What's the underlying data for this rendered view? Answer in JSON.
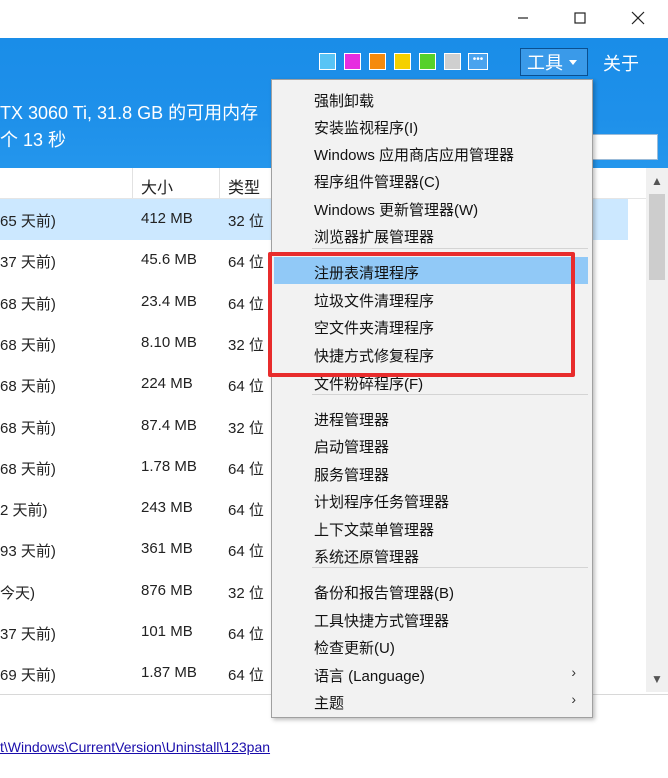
{
  "header": {
    "system_info": "TX 3060 Ti, 31.8 GB 的可用内存",
    "time_info": "个 13 秒",
    "tools_label": "工具",
    "about_label": "关于",
    "more_label": "•••",
    "swatches": [
      "#58c4f5",
      "#e62ee0",
      "#f58a0c",
      "#f5d000",
      "#56d12a",
      "#cfcfcf"
    ]
  },
  "columns": {
    "size": "大小",
    "type": "类型"
  },
  "rows": [
    {
      "date": "65 天前)",
      "size": "412 MB",
      "type": "32 位",
      "selected": true
    },
    {
      "date": "37 天前)",
      "size": "45.6 MB",
      "type": "64 位"
    },
    {
      "date": "68 天前)",
      "size": "23.4 MB",
      "type": "64 位"
    },
    {
      "date": "68 天前)",
      "size": "8.10 MB",
      "type": "32 位"
    },
    {
      "date": "68 天前)",
      "size": "224 MB",
      "type": "64 位"
    },
    {
      "date": "68 天前)",
      "size": "87.4 MB",
      "type": "32 位"
    },
    {
      "date": "68 天前)",
      "size": "1.78 MB",
      "type": "64 位"
    },
    {
      "date": "2 天前)",
      "size": "243 MB",
      "type": "64 位"
    },
    {
      "date": "93 天前)",
      "size": "361 MB",
      "type": "64 位"
    },
    {
      "date": "今天)",
      "size": "876 MB",
      "type": "32 位"
    },
    {
      "date": "37 天前)",
      "size": "101 MB",
      "type": "64 位"
    },
    {
      "date": "69 天前)",
      "size": "1.87 MB",
      "type": "64 位"
    }
  ],
  "bottom": {
    "registry_path": "t\\Windows\\CurrentVersion\\Uninstall\\123pan"
  },
  "menu": {
    "items": [
      "强制卸载",
      "安装监视程序(I)",
      "Windows 应用商店应用管理器",
      "程序组件管理器(C)",
      "Windows 更新管理器(W)",
      "浏览器扩展管理器",
      "注册表清理程序",
      "垃圾文件清理程序",
      "空文件夹清理程序",
      "快捷方式修复程序",
      "文件粉碎程序(F)",
      "进程管理器",
      "启动管理器",
      "服务管理器",
      "计划程序任务管理器",
      "上下文菜单管理器",
      "系统还原管理器",
      "备份和报告管理器(B)",
      "工具快捷方式管理器",
      "检查更新(U)",
      "语言 (Language)",
      "主题"
    ],
    "highlighted_index": 6,
    "submenu_arrow": "›"
  },
  "annotation_color": "#e82c2c"
}
